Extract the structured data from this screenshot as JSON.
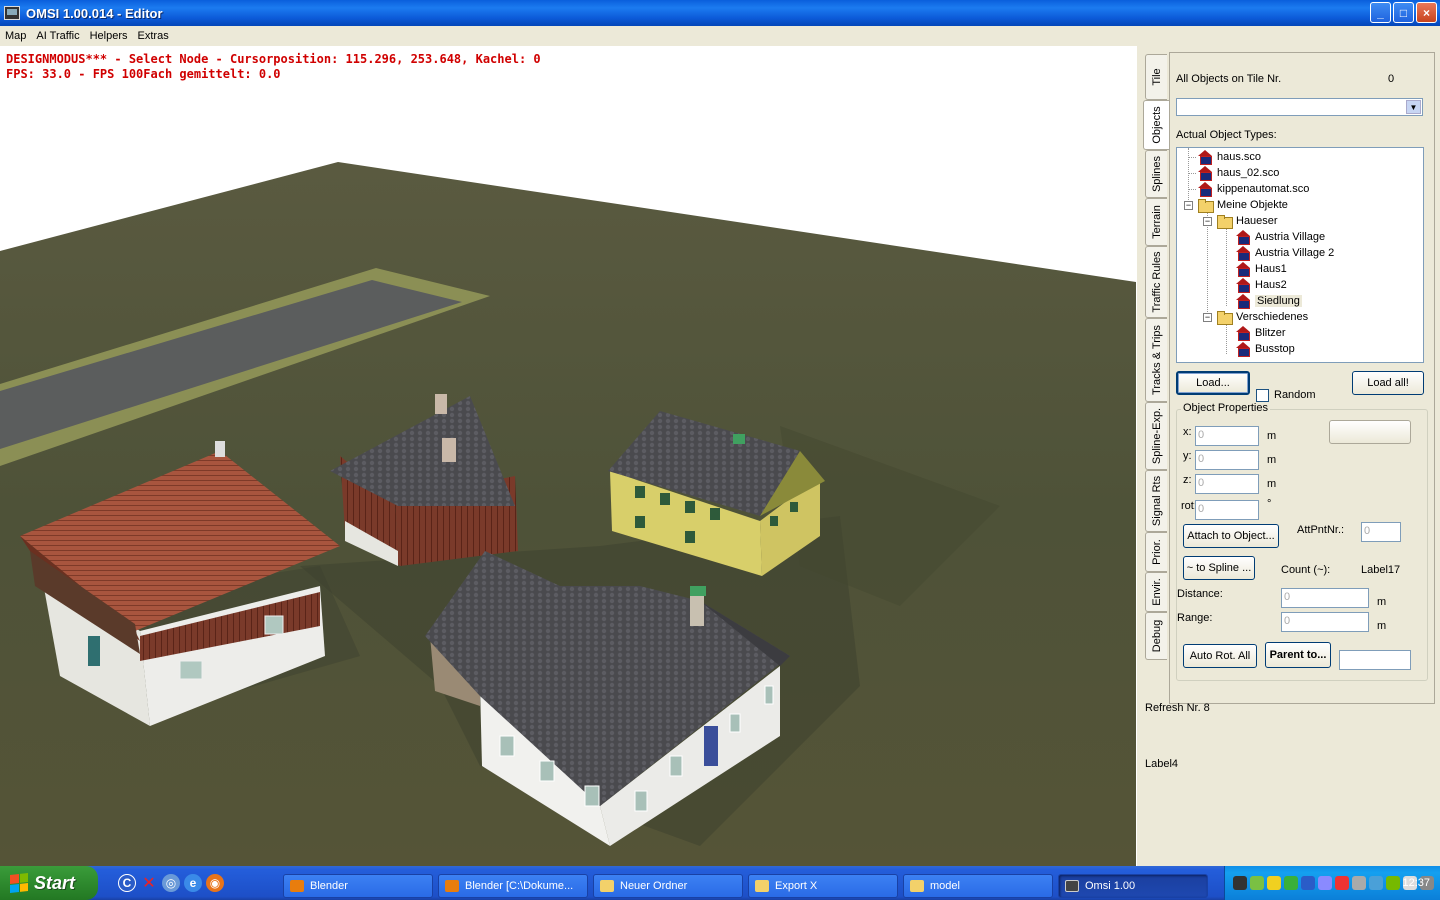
{
  "window": {
    "title": "OMSI 1.00.014 - Editor",
    "minimize": "_",
    "maximize": "□",
    "close": "×"
  },
  "menu": [
    "Map",
    "AI Traffic",
    "Helpers",
    "Extras"
  ],
  "viewport": {
    "status_line_1": "DESIGNMODUS*** - Select Node - Cursorposition: 115.296, 253.648, Kachel: 0",
    "status_line_2": "FPS: 33.0 - FPS 100Fach gemittelt: 0.0"
  },
  "tabs": [
    "Tile",
    "Objects",
    "Splines",
    "Terrain",
    "Traffic Rules",
    "Tracks & Trips",
    "Spline-Exp.",
    "Signal Rts",
    "Prior.",
    "Envir.",
    "Debug"
  ],
  "active_tab": "Objects",
  "objects": {
    "all_objects_label": "All Objects on Tile Nr.",
    "all_objects_count": "0",
    "combo_value": "",
    "actual_types_label": "Actual Object Types:",
    "tree": [
      {
        "label": "haus.sco",
        "type": "object",
        "level": 0
      },
      {
        "label": "haus_02.sco",
        "type": "object",
        "level": 0
      },
      {
        "label": "kippenautomat.sco",
        "type": "object",
        "level": 0
      },
      {
        "label": "Meine Objekte",
        "type": "folder",
        "level": 0
      },
      {
        "label": "Haueser",
        "type": "folder",
        "level": 1
      },
      {
        "label": "Austria Village",
        "type": "object",
        "level": 2
      },
      {
        "label": "Austria Village 2",
        "type": "object",
        "level": 2
      },
      {
        "label": "Haus1",
        "type": "object",
        "level": 2
      },
      {
        "label": "Haus2",
        "type": "object",
        "level": 2
      },
      {
        "label": "Siedlung",
        "type": "object",
        "level": 2,
        "selected": true
      },
      {
        "label": "Verschiedenes",
        "type": "folder",
        "level": 1
      },
      {
        "label": "Blitzer",
        "type": "object",
        "level": 2
      },
      {
        "label": "Busstop",
        "type": "object",
        "level": 2
      }
    ],
    "load_button": "Load...",
    "random_label": "Random",
    "load_all_button": "Load all!",
    "properties": {
      "title": "Object Properties",
      "x_label": "x:",
      "x_value": "0",
      "x_unit": "m",
      "y_label": "y:",
      "y_value": "0",
      "y_unit": "m",
      "z_label": "z:",
      "z_value": "0",
      "z_unit": "m",
      "rot_label": "rot:",
      "rot_value": "0",
      "rot_unit": "°",
      "attach_button": "Attach to Object...",
      "attpnt_label": "AttPntNr.:",
      "attpnt_value": "0",
      "spline_button": "~ to Spline ...",
      "count_label": "Count (~):",
      "count_value": "Label17",
      "distance_label": "Distance:",
      "distance_value": "0",
      "distance_unit": "m",
      "range_label": "Range:",
      "range_value": "0",
      "range_unit": "m",
      "auto_rot_button": "Auto Rot. All",
      "parent_button": "Parent to..."
    }
  },
  "refresh_label": "Refresh Nr. 8",
  "label4": "Label4",
  "taskbar": {
    "start": "Start",
    "tasks": [
      {
        "label": "Blender",
        "color": "#e87d0d"
      },
      {
        "label": "Blender [C:\\Dokume...",
        "color": "#e87d0d"
      },
      {
        "label": "Neuer Ordner",
        "color": "#f3d16a"
      },
      {
        "label": "Export X",
        "color": "#f3d16a"
      },
      {
        "label": "model",
        "color": "#f3d16a"
      },
      {
        "label": "Omsi 1.00",
        "color": "#444444",
        "active": true
      }
    ],
    "clock": "12:37"
  }
}
